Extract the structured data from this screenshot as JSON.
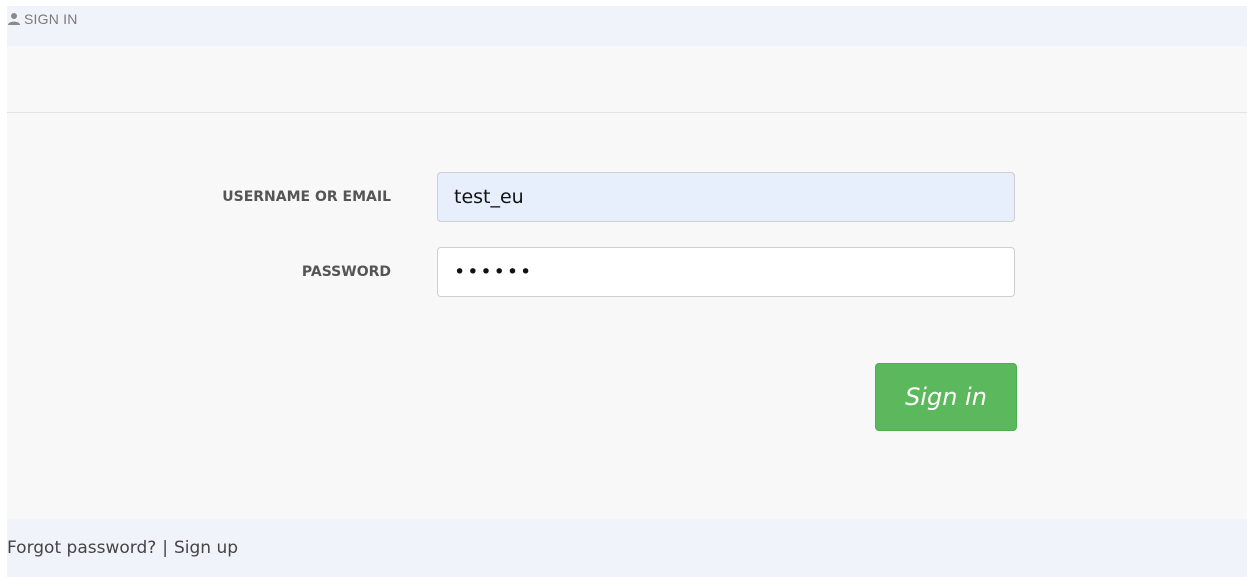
{
  "header": {
    "icon": "user-icon",
    "title": "SIGN IN"
  },
  "form": {
    "username_label": "USERNAME OR EMAIL",
    "username_value": "test_eu",
    "password_label": "PASSWORD",
    "password_value": "••••••",
    "submit_label": "Sign in"
  },
  "footer": {
    "forgot_label": "Forgot password?",
    "separator": "|",
    "signup_label": "Sign up"
  },
  "colors": {
    "header_bg": "#f0f4fa",
    "panel_bg": "#f8f8f8",
    "autofill_bg": "#e6effb",
    "button_green": "#5cb85c"
  }
}
